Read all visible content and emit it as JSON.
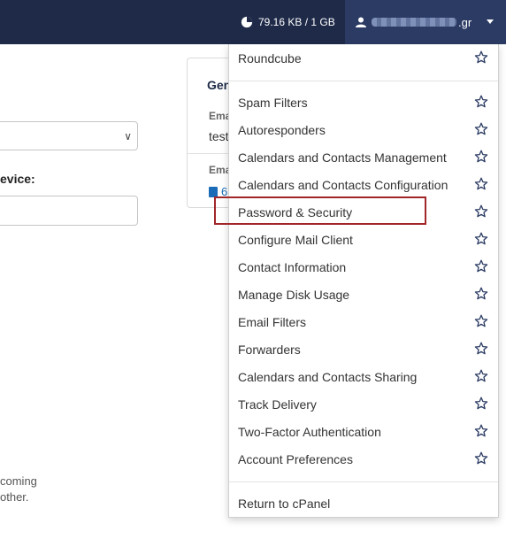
{
  "topbar": {
    "disk_usage": "79.16 KB / 1 GB",
    "username_suffix": ".gr",
    "icons": [
      "pie-chart-icon",
      "user-icon",
      "caret-down-icon"
    ]
  },
  "background": {
    "device_label": "evice:",
    "bottom_line1": "coming",
    "bottom_line2": "other.",
    "card": {
      "heading": "Gen",
      "label1": "Ema",
      "value1": "test",
      "label2": "Ema",
      "link_text": "6"
    }
  },
  "menu": {
    "top_item": "Roundcube",
    "items": [
      "Spam Filters",
      "Autoresponders",
      "Calendars and Contacts Management",
      "Calendars and Contacts Configuration",
      "Password & Security",
      "Configure Mail Client",
      "Contact Information",
      "Manage Disk Usage",
      "Email Filters",
      "Forwarders",
      "Calendars and Contacts Sharing",
      "Track Delivery",
      "Two-Factor Authentication",
      "Account Preferences"
    ],
    "bottom_item": "Return to cPanel",
    "highlighted_item": "Password & Security",
    "highlight_color": "#a0262a"
  }
}
